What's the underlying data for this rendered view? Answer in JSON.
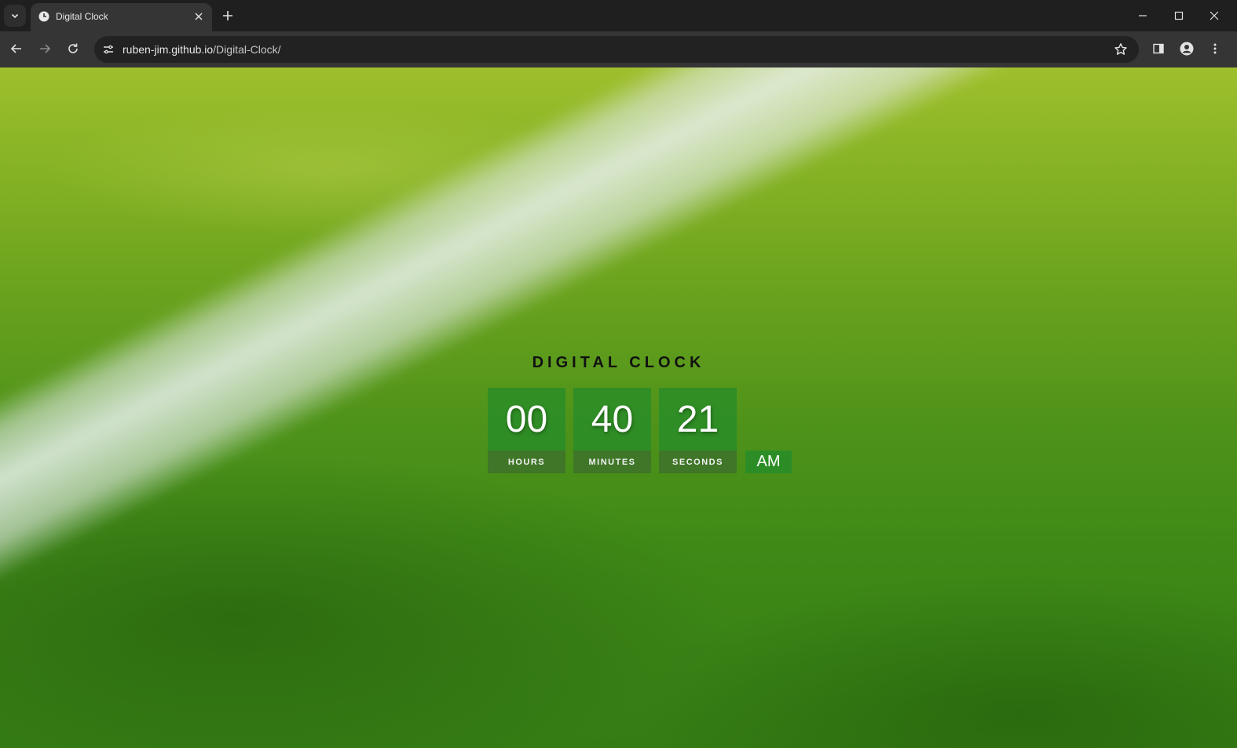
{
  "browser": {
    "tab_title": "Digital Clock",
    "url_host": "ruben-jim.github.io",
    "url_path": "/Digital-Clock/"
  },
  "clock": {
    "title": "DIGITAL CLOCK",
    "hours": "00",
    "minutes": "40",
    "seconds": "21",
    "hours_label": "HOURS",
    "minutes_label": "MINUTES",
    "seconds_label": "SECONDS",
    "period": "AM"
  },
  "colors": {
    "accent_green": "#288c28",
    "chrome_dark": "#1f1f1f",
    "chrome_toolbar": "#353535"
  }
}
